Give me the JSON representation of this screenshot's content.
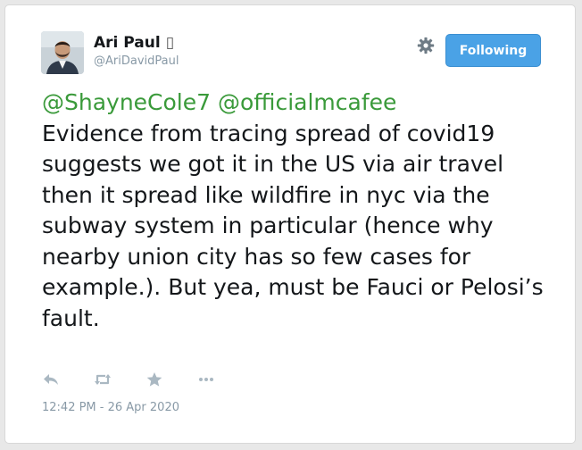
{
  "author": {
    "name": "Ari Paul",
    "badge": "▯",
    "handle": "@AriDavidPaul",
    "avatar_icon": "profile-photo"
  },
  "header": {
    "settings_icon": "gear-icon",
    "follow_label": "Following"
  },
  "tweet": {
    "mentions": [
      "@ShayneCole7",
      "@officialmcafee"
    ],
    "body": "Evidence from tracing spread of covid19 suggests we got it in the US via air travel then it spread like wildfire in nyc via the subway system in particular (hence why nearby union city has so few cases for example.). But yea, must be Fauci or Pelosi’s fault."
  },
  "actions": [
    "reply-icon",
    "retweet-icon",
    "like-star-icon",
    "more-icon"
  ],
  "timestamp": "12:42 PM - 26 Apr 2020",
  "colors": {
    "mention": "#3a9a3a",
    "button": "#4aa2e6",
    "muted": "#8899a6",
    "icon": "#aab8c2"
  }
}
